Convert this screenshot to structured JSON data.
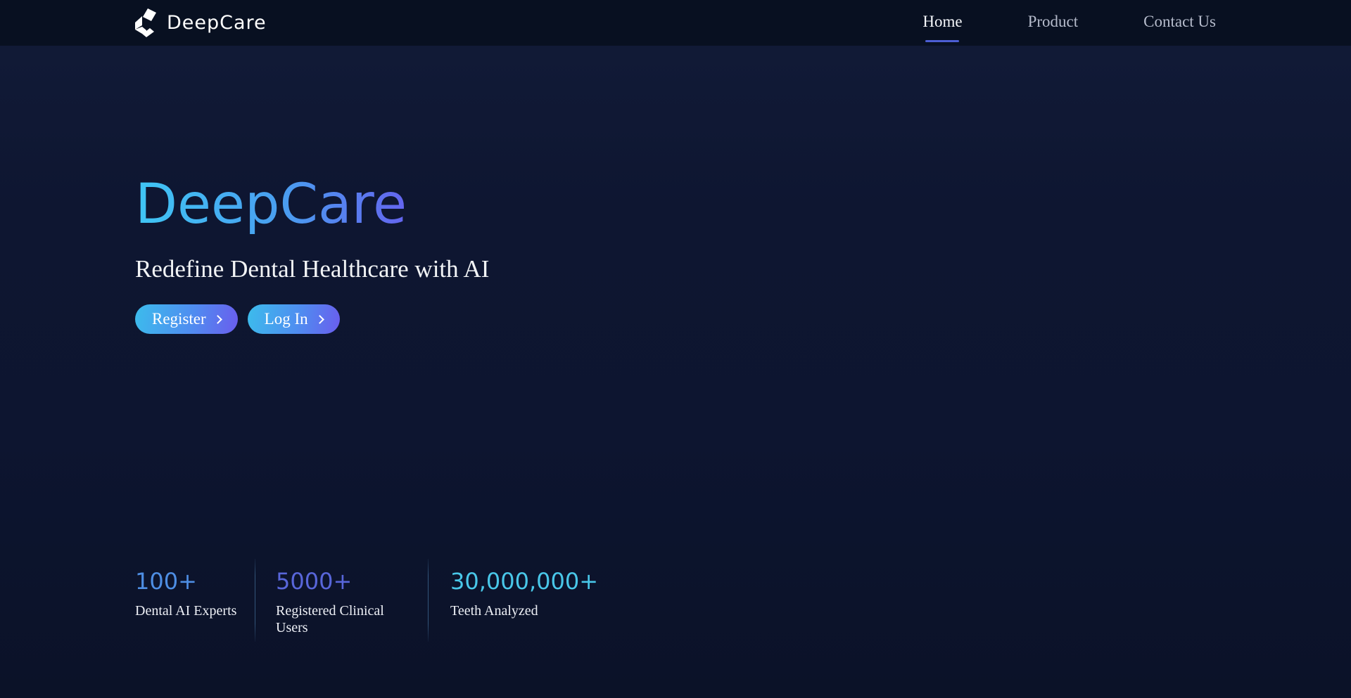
{
  "navbar": {
    "brand": "DeepCare",
    "links": [
      {
        "label": "Home",
        "active": true
      },
      {
        "label": "Product",
        "active": false
      },
      {
        "label": "Contact Us",
        "active": false
      }
    ]
  },
  "hero": {
    "title": "DeepCare",
    "subtitle": "Redefine Dental Healthcare with AI",
    "register_label": "Register",
    "login_label": "Log In"
  },
  "stats": [
    {
      "value": "100+",
      "label": "Dental AI Experts",
      "color": "#4e8ee4"
    },
    {
      "value": "5000+",
      "label": "Registered Clinical Users",
      "color": "#5866da"
    },
    {
      "value": "30,000,000+",
      "label": "Teeth Analyzed",
      "color": "#49c7e9"
    }
  ],
  "icons": {
    "logo": "deepcare-logo-icon",
    "chevron": "chevron-right-icon"
  },
  "colors": {
    "background": "#0d1530",
    "navbar_bg": "#081021",
    "title_gradient_start": "#3fc6f4",
    "title_gradient_end": "#6464ef",
    "button_gradient_start": "#3cbcec",
    "button_gradient_end": "#6a5ded",
    "active_underline": "#4c5ed4",
    "nav_inactive": "#b6bccc"
  }
}
